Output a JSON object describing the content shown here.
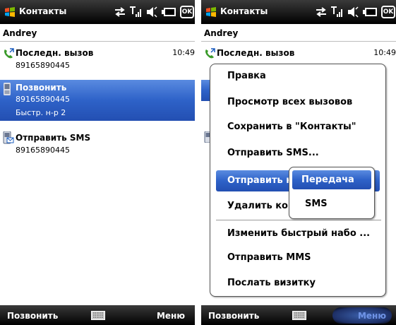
{
  "left": {
    "title": "Контакты",
    "ok_label": "OK",
    "contact_name": "Andrey",
    "rows": [
      {
        "label": "Последн. вызов",
        "number": "89165890445",
        "time": "10:49"
      },
      {
        "label": "Позвонить",
        "number": "89165890445",
        "speed_dial": "Быстр. н-р 2"
      },
      {
        "label": "Отправить SMS",
        "number": "89165890445"
      }
    ],
    "softkeys": {
      "left": "Позвонить",
      "right": "Меню"
    }
  },
  "right": {
    "title": "Контакты",
    "ok_label": "OK",
    "contact_name": "Andrey",
    "rows": [
      {
        "label": "Последн. вызов",
        "time": "10:49"
      }
    ],
    "menu": {
      "items": [
        "Правка",
        "Просмотр всех вызовов",
        "Сохранить в \"Контакты\"",
        "Отправить SMS...",
        "Отправить к",
        "Удалить ко",
        "Изменить быстрый набо ...",
        "Отправить MMS",
        "Послать визитку"
      ],
      "selected_index": 4
    },
    "submenu": {
      "items": [
        "Передача",
        "SMS"
      ],
      "selected_index": 0
    },
    "softkeys": {
      "left": "Позвонить",
      "right": "Меню"
    }
  },
  "colors": {
    "selection": "#2e62c8",
    "titlebar": "#000000",
    "menu_pressed_text": "#6f93e6"
  },
  "icons": [
    "windows-logo-icon",
    "connectivity-icon",
    "signal-icon",
    "volume-icon",
    "battery-icon",
    "recent-call-icon",
    "phone-icon",
    "sms-icon",
    "keyboard-icon"
  ]
}
